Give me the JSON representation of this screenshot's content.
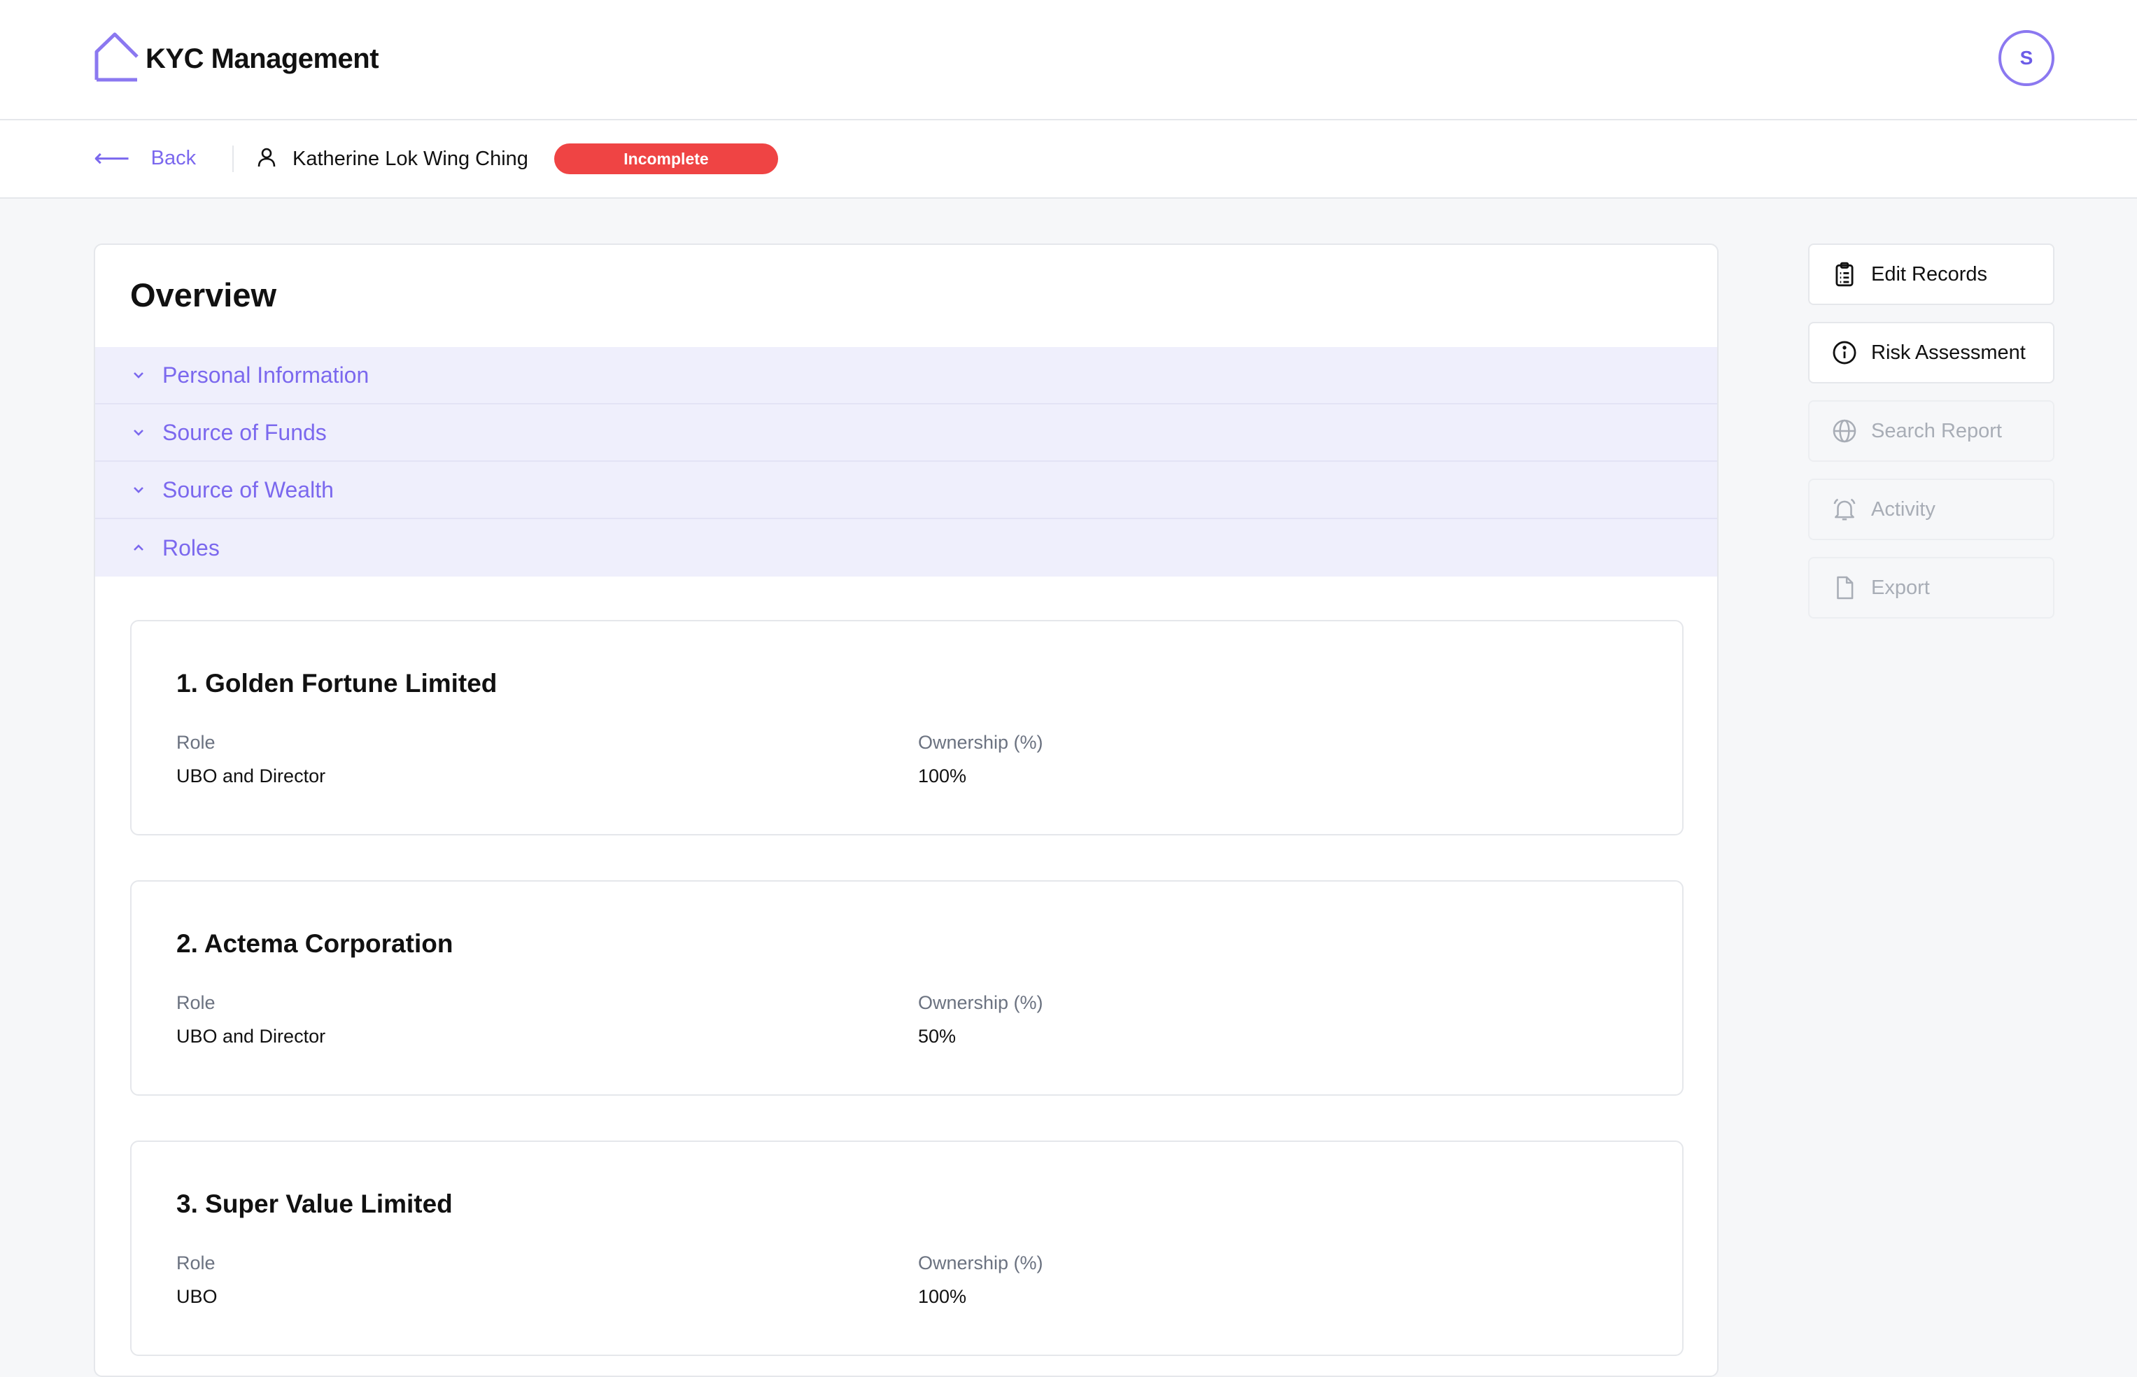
{
  "app": {
    "title": "KYC Management",
    "user_initial": "S"
  },
  "subheader": {
    "back_label": "Back",
    "person_name": "Katherine Lok Wing Ching",
    "status": "Incomplete"
  },
  "overview": {
    "title": "Overview",
    "sections": [
      {
        "label": "Personal Information",
        "expanded": false
      },
      {
        "label": "Source of Funds",
        "expanded": false
      },
      {
        "label": "Source of Wealth",
        "expanded": false
      },
      {
        "label": "Roles",
        "expanded": true
      }
    ],
    "role_field_label": "Role",
    "ownership_field_label": "Ownership (%)",
    "roles": [
      {
        "title": "1. Golden Fortune Limited",
        "role": "UBO and Director",
        "ownership": "100%"
      },
      {
        "title": "2. Actema Corporation",
        "role": "UBO and Director",
        "ownership": "50%"
      },
      {
        "title": "3. Super Value Limited",
        "role": "UBO",
        "ownership": "100%"
      }
    ]
  },
  "actions": [
    {
      "label": "Edit Records",
      "icon": "clipboard-icon",
      "enabled": true
    },
    {
      "label": "Risk Assessment",
      "icon": "info-icon",
      "enabled": true
    },
    {
      "label": "Search Report",
      "icon": "globe-icon",
      "enabled": false
    },
    {
      "label": "Activity",
      "icon": "bell-icon",
      "enabled": false
    },
    {
      "label": "Export",
      "icon": "file-icon",
      "enabled": false
    }
  ],
  "colors": {
    "accent": "#7b68ee",
    "status_incomplete": "#ef4444",
    "accordion_bg": "#efeffc",
    "page_bg": "#f6f7f9"
  }
}
